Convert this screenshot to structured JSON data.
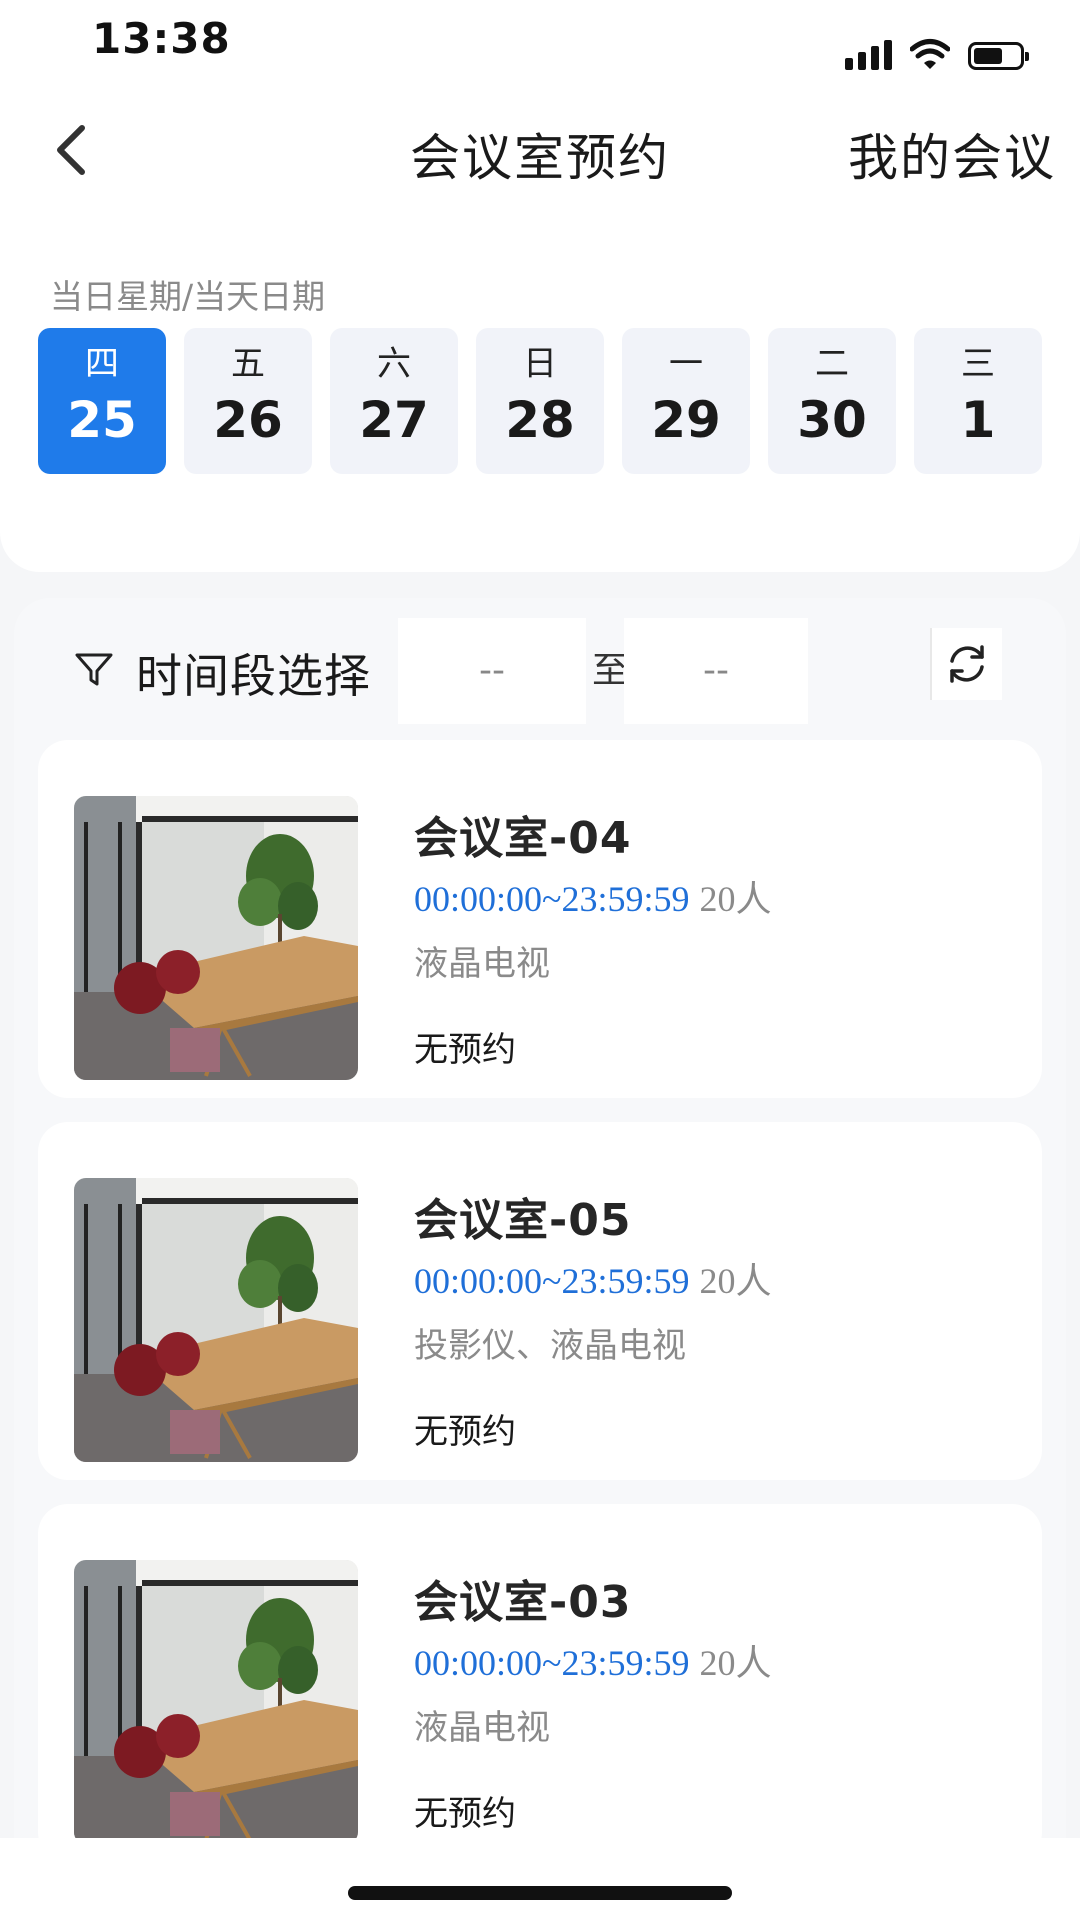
{
  "status_bar": {
    "time": "13:38",
    "icons": [
      "signal-icon",
      "wifi-icon",
      "battery-icon"
    ]
  },
  "header": {
    "back_icon": "chevron-left-icon",
    "title": "会议室预约",
    "my_meetings": "我的会议"
  },
  "date_picker": {
    "label": "当日星期/当天日期",
    "selected_index": 0,
    "accent_color": "#1f7bea",
    "days": [
      {
        "weekday": "四",
        "day": "25"
      },
      {
        "weekday": "五",
        "day": "26"
      },
      {
        "weekday": "六",
        "day": "27"
      },
      {
        "weekday": "日",
        "day": "28"
      },
      {
        "weekday": "一",
        "day": "29"
      },
      {
        "weekday": "二",
        "day": "30"
      },
      {
        "weekday": "三",
        "day": "1"
      }
    ]
  },
  "filter": {
    "icon": "filter-icon",
    "label": "时间段选择",
    "start_value": "--",
    "separator": "至",
    "end_value": "--",
    "refresh_icon": "refresh-icon"
  },
  "rooms": [
    {
      "name": "会议室-04",
      "hours": "00:00:00~23:59:59",
      "capacity": "20人",
      "equipment": "液晶电视",
      "status": "无预约"
    },
    {
      "name": "会议室-05",
      "hours": "00:00:00~23:59:59",
      "capacity": "20人",
      "equipment": "投影仪、液晶电视",
      "status": "无预约"
    },
    {
      "name": "会议室-03",
      "hours": "00:00:00~23:59:59",
      "capacity": "20人",
      "equipment": "液晶电视",
      "status": "无预约"
    }
  ],
  "colors": {
    "accent": "#1f7bea",
    "time_text": "#1f6fd8",
    "muted_text": "#8a8a8a"
  }
}
